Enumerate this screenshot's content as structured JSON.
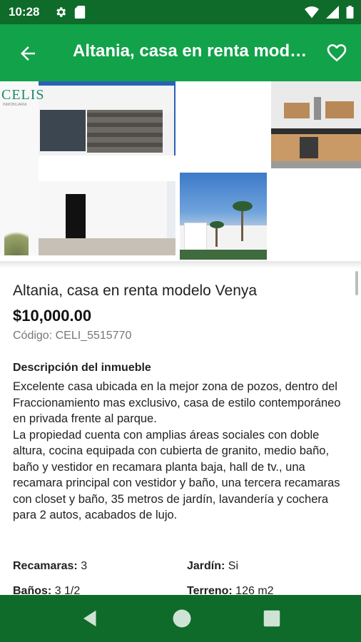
{
  "status_bar": {
    "time": "10:28",
    "icons": [
      "gear-icon",
      "sd-card-icon",
      "wifi-icon",
      "signal-icon",
      "battery-icon"
    ]
  },
  "app_bar": {
    "title": "Altania, casa en renta modelo Venya",
    "back_icon": "arrow-back-icon",
    "favorite_icon": "heart-outline-icon"
  },
  "gallery": {
    "logo_text": "CELIS",
    "logo_subtext": "INMOBILIARIA"
  },
  "property": {
    "title": "Altania, casa en renta modelo Venya",
    "price": "$10,000.00",
    "code": "Código: CELI_5515770",
    "description_heading": "Descripción del inmueble",
    "description": "Excelente casa ubicada en la mejor zona de pozos, dentro del Fraccionamiento mas exclusivo, casa de estilo contemporáneo en privada frente al parque.\nLa propiedad cuenta con amplias áreas sociales con doble altura, cocina equipada con cubierta de granito, medio baño, baño y vestidor en recamara planta baja, hall de tv., una recamara principal con vestidor y baño, una tercera recamaras con closet y baño, 35 metros de jardín, lavandería y cochera para 2 autos, acabados de lujo.",
    "features": [
      {
        "label": "Recamaras:",
        "value": "3"
      },
      {
        "label": "Jardín:",
        "value": "Si"
      },
      {
        "label": "Baños:",
        "value": "3 1/2"
      },
      {
        "label": "Terreno:",
        "value": "126 m2"
      }
    ]
  },
  "nav_bar": {
    "icons": [
      "back-triangle-icon",
      "home-circle-icon",
      "recents-square-icon"
    ]
  },
  "colors": {
    "status_bar": "#0e6b2a",
    "app_bar": "#12a24a",
    "nav_bar": "#0e6b2a"
  }
}
